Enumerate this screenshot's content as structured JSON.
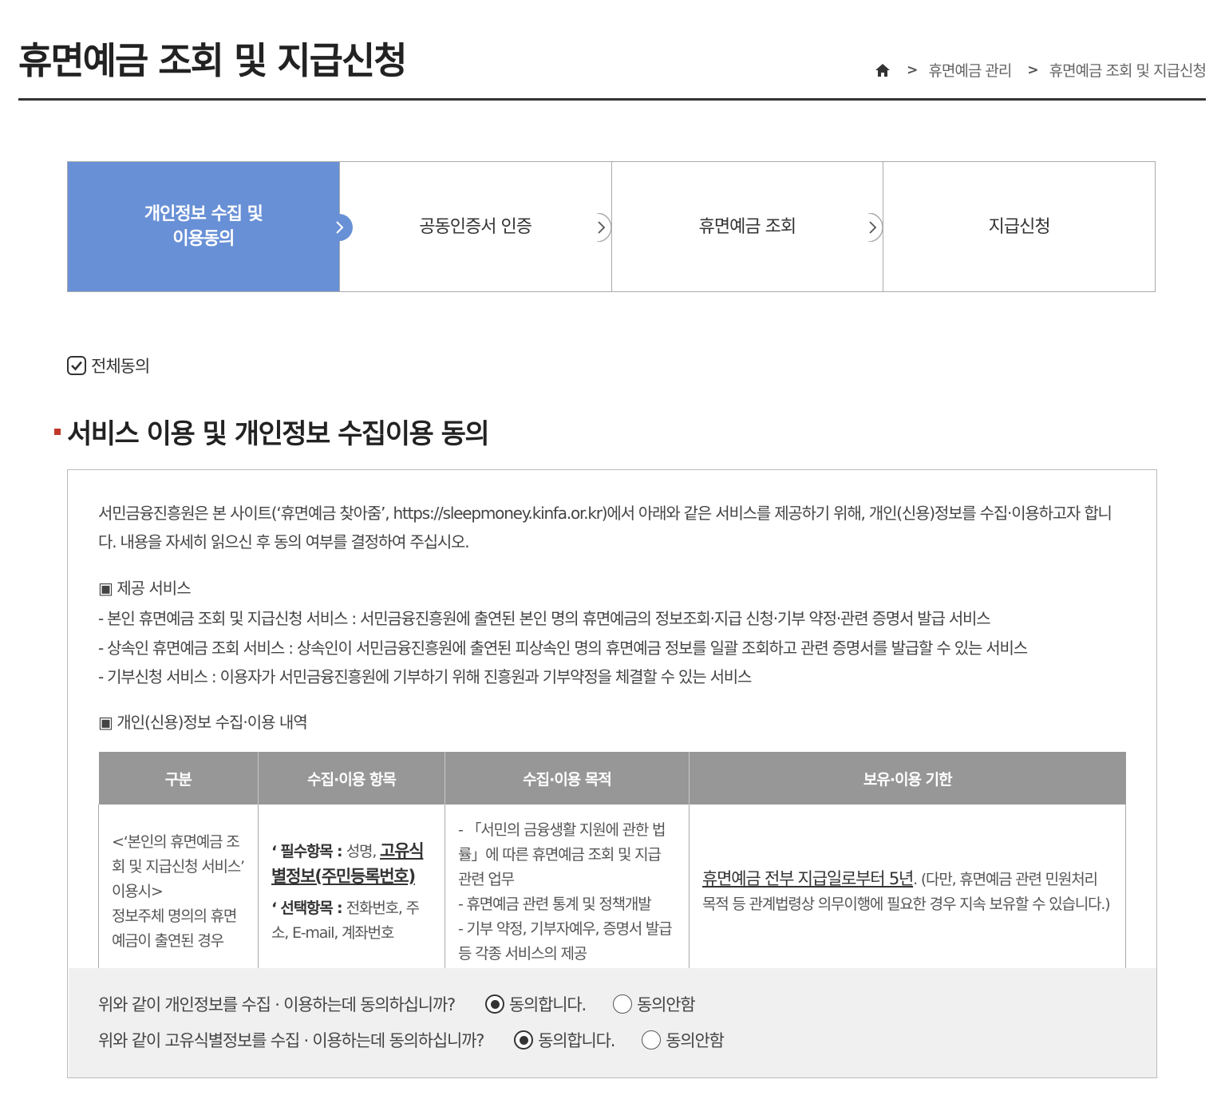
{
  "header": {
    "title": "휴면예금 조회 및 지급신청",
    "breadcrumb": [
      "휴면예금 관리",
      "휴면예금 조회 및 지급신청"
    ]
  },
  "steps": [
    {
      "line1": "개인정보 수집 및",
      "line2": "이용동의",
      "active": true
    },
    {
      "line1": "공동인증서 인증",
      "line2": "",
      "active": false
    },
    {
      "line1": "휴면예금 조회",
      "line2": "",
      "active": false
    },
    {
      "line1": "지급신청",
      "line2": "",
      "active": false
    }
  ],
  "all_agree": {
    "label": "전체동의",
    "checked": true
  },
  "section": {
    "title": "서비스 이용 및 개인정보 수집이용 동의"
  },
  "intro": {
    "line1": "서민금융진흥원은 본 사이트(‘휴면예금 찾아줌’, https://sleepmoney.kinfa.or.kr)에서 아래와 같은 서비스를 제공하기 위해, 개인(신용)정보를 수집·이용하고자 합니",
    "line2": "다. 내용을 자세히 읽으신 후 동의 여부를 결정하여 주십시오."
  },
  "services": {
    "heading": "▣ 제공 서비스",
    "items": [
      "- 본인 휴면예금 조회 및 지급신청 서비스 : 서민금융진흥원에 출연된 본인 명의 휴면예금의 정보조회·지급 신청·기부 약정·관련 증명서 발급 서비스",
      "- 상속인 휴면예금 조회 서비스 : 상속인이 서민금융진흥원에 출연된 피상속인 명의 휴면예금 정보를 일괄 조회하고 관련 증명서를 발급할 수 있는 서비스",
      "- 기부신청 서비스 : 이용자가 서민금융진흥원에 기부하기 위해 진흥원과 기부약정을 체결할 수 있는 서비스"
    ]
  },
  "pi_table": {
    "heading": "▣ 개인(신용)정보 수집·이용 내역",
    "headers": [
      "구분",
      "수집·이용 항목",
      "수집·이용 목적",
      "보유·이용 기한"
    ],
    "row": {
      "category": [
        "<‘본인의 휴면예금 조",
        "회 및 지급신청 서비스’",
        "이용시>",
        "정보주체 명의의 휴면",
        "예금이 출연된 경우"
      ],
      "items": {
        "required_label": "‘ 필수항목 : ",
        "required_text": "성명, ",
        "required_emph": "고유식별정보(주민등록번호)",
        "optional_label": "‘ 선택항목 : ",
        "optional_text": "전화번호, 주소, E-mail, 계좌번호"
      },
      "purpose": [
        "- 「서민의 금융생활 지원에 관한 법률」에 따른 휴면예금 조회 및 지급 관련 업무",
        "- 휴면예금 관련 통계 및 정책개발",
        "- 기부 약정, 기부자예우, 증명서 발급 등 각종 서비스의 제공"
      ],
      "retention_emph": "휴면예금 전부 지급일로부터 5년",
      "retention_text": ". (다만, 휴면예금 관련 민원처리 목적 등 관계법령상 의무이행에 필요한 경우 지속 보유할 수 있습니다.)"
    }
  },
  "consent": [
    {
      "question": "위와 같이 개인정보를 수집 · 이용하는데 동의하십니까?",
      "agree": "동의합니다.",
      "disagree": "동의안함",
      "selected": "agree"
    },
    {
      "question": "위와 같이 고유식별정보를 수집 · 이용하는데 동의하십니까?",
      "agree": "동의합니다.",
      "disagree": "동의안함",
      "selected": "agree"
    }
  ],
  "colors": {
    "accent": "#6890d6",
    "table_header": "#979797",
    "bullet": "#c0392b",
    "panel": "#f0f0f0"
  }
}
